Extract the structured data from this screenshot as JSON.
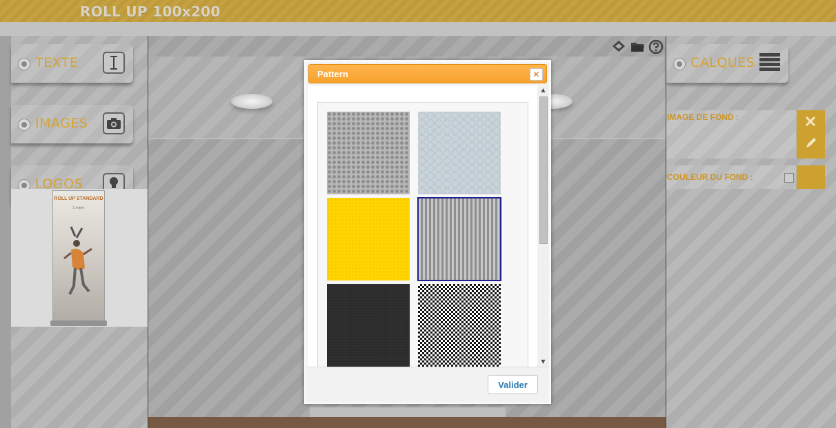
{
  "header": {
    "title": "ROLL UP 100x200"
  },
  "left_tools": [
    {
      "label": "TEXTE",
      "icon": "text-cursor-icon"
    },
    {
      "label": "IMAGES",
      "icon": "camera-icon"
    },
    {
      "label": "LOGOS",
      "icon": "lightbulb-icon"
    }
  ],
  "thumbnail": {
    "title": "ROLL UP STANDARD",
    "subtitle": "1 mètre"
  },
  "canvas_icons": [
    "layers-icon",
    "folder-icon",
    "help-icon"
  ],
  "right_panel": {
    "calques_label": "CALQUES",
    "image_fond_label": "IMAGE DE FOND :",
    "couleur_fond_label": "COULEUR DU FOND :"
  },
  "modal": {
    "title": "Pattern",
    "close_symbol": "✕",
    "validate_label": "Valider",
    "patterns": [
      {
        "name": "grey-dots",
        "selected": false
      },
      {
        "name": "blue-hexagon",
        "selected": false
      },
      {
        "name": "yellow",
        "selected": false
      },
      {
        "name": "grey-stripes",
        "selected": true
      },
      {
        "name": "dark-texture",
        "selected": false
      },
      {
        "name": "black-checker",
        "selected": false
      }
    ]
  },
  "colors": {
    "accent": "#f7a22d",
    "label_orange": "#d39c1f",
    "topbar": "#c09a32",
    "button_text": "#2c7bb0"
  }
}
